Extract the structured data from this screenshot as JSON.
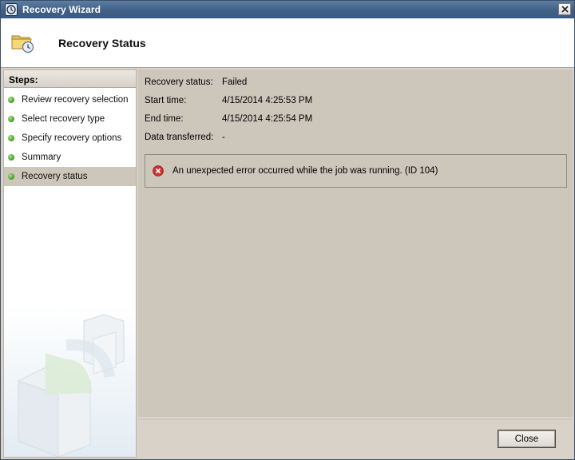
{
  "window": {
    "title": "Recovery Wizard",
    "icon": "recovery-wizard-icon"
  },
  "header": {
    "title": "Recovery Status",
    "icon": "folder-clock-icon"
  },
  "steps": {
    "title": "Steps:",
    "items": [
      {
        "label": "Review recovery selection",
        "active": false
      },
      {
        "label": "Select recovery type",
        "active": false
      },
      {
        "label": "Specify recovery options",
        "active": false
      },
      {
        "label": "Summary",
        "active": false
      },
      {
        "label": "Recovery status",
        "active": true
      }
    ]
  },
  "status": {
    "recovery_status_label": "Recovery status:",
    "recovery_status_value": "Failed",
    "start_time_label": "Start time:",
    "start_time_value": "4/15/2014 4:25:53 PM",
    "end_time_label": "End time:",
    "end_time_value": "4/15/2014 4:25:54 PM",
    "data_transferred_label": "Data transferred:",
    "data_transferred_value": "-"
  },
  "error": {
    "message": "An unexpected error occurred while the job was running. (ID 104)",
    "icon": "error-icon",
    "color": "#c62828"
  },
  "footer": {
    "close_label": "Close"
  },
  "colors": {
    "step_dot": "#3f9a22",
    "active_step_bg": "#cdc6ba"
  }
}
